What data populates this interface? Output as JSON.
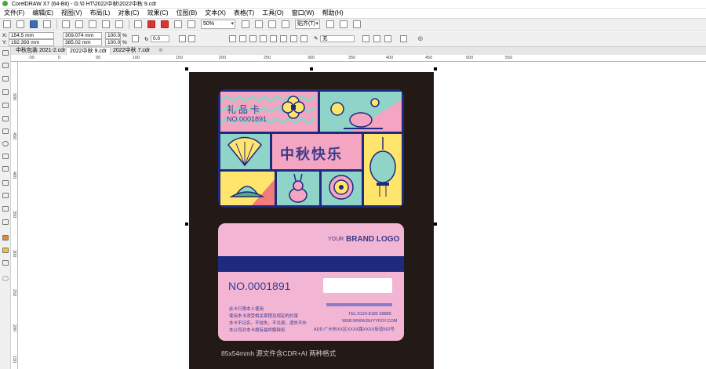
{
  "window": {
    "title": "CorelDRAW X7 (64-Bit) - G:\\0 HT\\2022中秋\\2022中秋 9.cdr"
  },
  "menu": {
    "items": [
      "文件(F)",
      "编辑(E)",
      "视图(V)",
      "布局(L)",
      "对象(C)",
      "效果(C)",
      "位图(B)",
      "文本(X)",
      "表格(T)",
      "工具(O)",
      "窗口(W)",
      "帮助(H)"
    ]
  },
  "toolbar": {
    "zoom": "50%",
    "snap": "贴齐(T)"
  },
  "props": {
    "x": "154.5 mm",
    "y": "192.393 mm",
    "w": "309.074 mm",
    "h": "385.02 mm",
    "scale_x": "100.0",
    "scale_y": "100.0",
    "unit": "%",
    "rotation": "0.0",
    "outline": "无"
  },
  "tabs": [
    {
      "label": "中秋包装 2021-2.cdr"
    },
    {
      "label": "2022中秋 9.cdr"
    },
    {
      "label": "2022中秋 7.cdr"
    }
  ],
  "ruler": {
    "h": [
      "-50",
      "0",
      "50",
      "100",
      "150",
      "200",
      "250",
      "300",
      "350",
      "400",
      "450",
      "500",
      "550"
    ],
    "v": [
      "500",
      "450",
      "400",
      "350",
      "300",
      "250",
      "200",
      "150"
    ]
  },
  "card_front": {
    "label": "礼品卡",
    "number": "NO.0001891",
    "greeting": "中秋快乐"
  },
  "card_back": {
    "brand_prefix": "YOUR",
    "brand": "BRAND LOGO",
    "number": "NO.0001891",
    "rules": [
      "此卡只限本人使用",
      "使用本卡须受相关章程及规定的约束",
      "本卡不记名，不挂失，不兑现，遗失不补",
      "本公司对本卡拥有最终解释权"
    ],
    "tel": "TEL:0123-8185 58889",
    "web": "WEB:WWW.BUYYFDY.COM",
    "addr": "ADD:广州市XX区XXXX路XXXX街道592号"
  },
  "caption": "85x54mmh    源文件含CDR+AI 两种格式",
  "colors": {
    "pink": "#f3b5d4",
    "navy": "#1e2a7e",
    "teal": "#8fd3c9",
    "yellow": "#ffe56b",
    "coral": "#f07c7c",
    "page": "#231a17"
  }
}
